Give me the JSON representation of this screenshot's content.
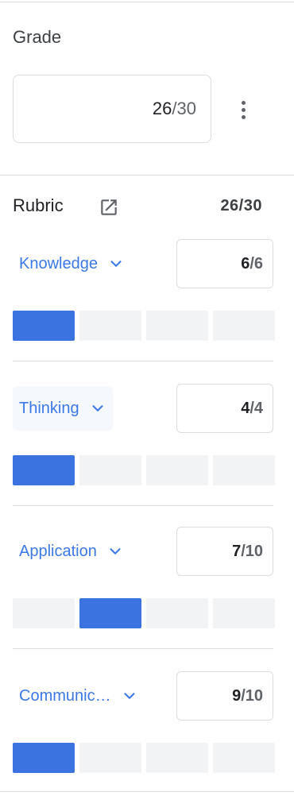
{
  "grade": {
    "title": "Grade",
    "score": "26",
    "separator": "/",
    "max": "30"
  },
  "rubric": {
    "title": "Rubric",
    "total": "26/30"
  },
  "criteria": [
    {
      "label": "Knowledge",
      "score": "6",
      "max": "6",
      "selected_level": 0,
      "highlighted": false
    },
    {
      "label": "Thinking",
      "score": "4",
      "max": "4",
      "selected_level": 0,
      "highlighted": true
    },
    {
      "label": "Application",
      "score": "7",
      "max": "10",
      "selected_level": 1,
      "highlighted": false
    },
    {
      "label": "Communic…",
      "score": "9",
      "max": "10",
      "selected_level": 0,
      "highlighted": false
    }
  ],
  "colors": {
    "accent": "#3b74e0",
    "link": "#3b78e7",
    "level_empty": "#f1f3f4",
    "border": "#dadce0"
  },
  "icons": {
    "more": "more-vert-icon",
    "open": "open-in-new-icon",
    "expand": "chevron-down-icon"
  }
}
